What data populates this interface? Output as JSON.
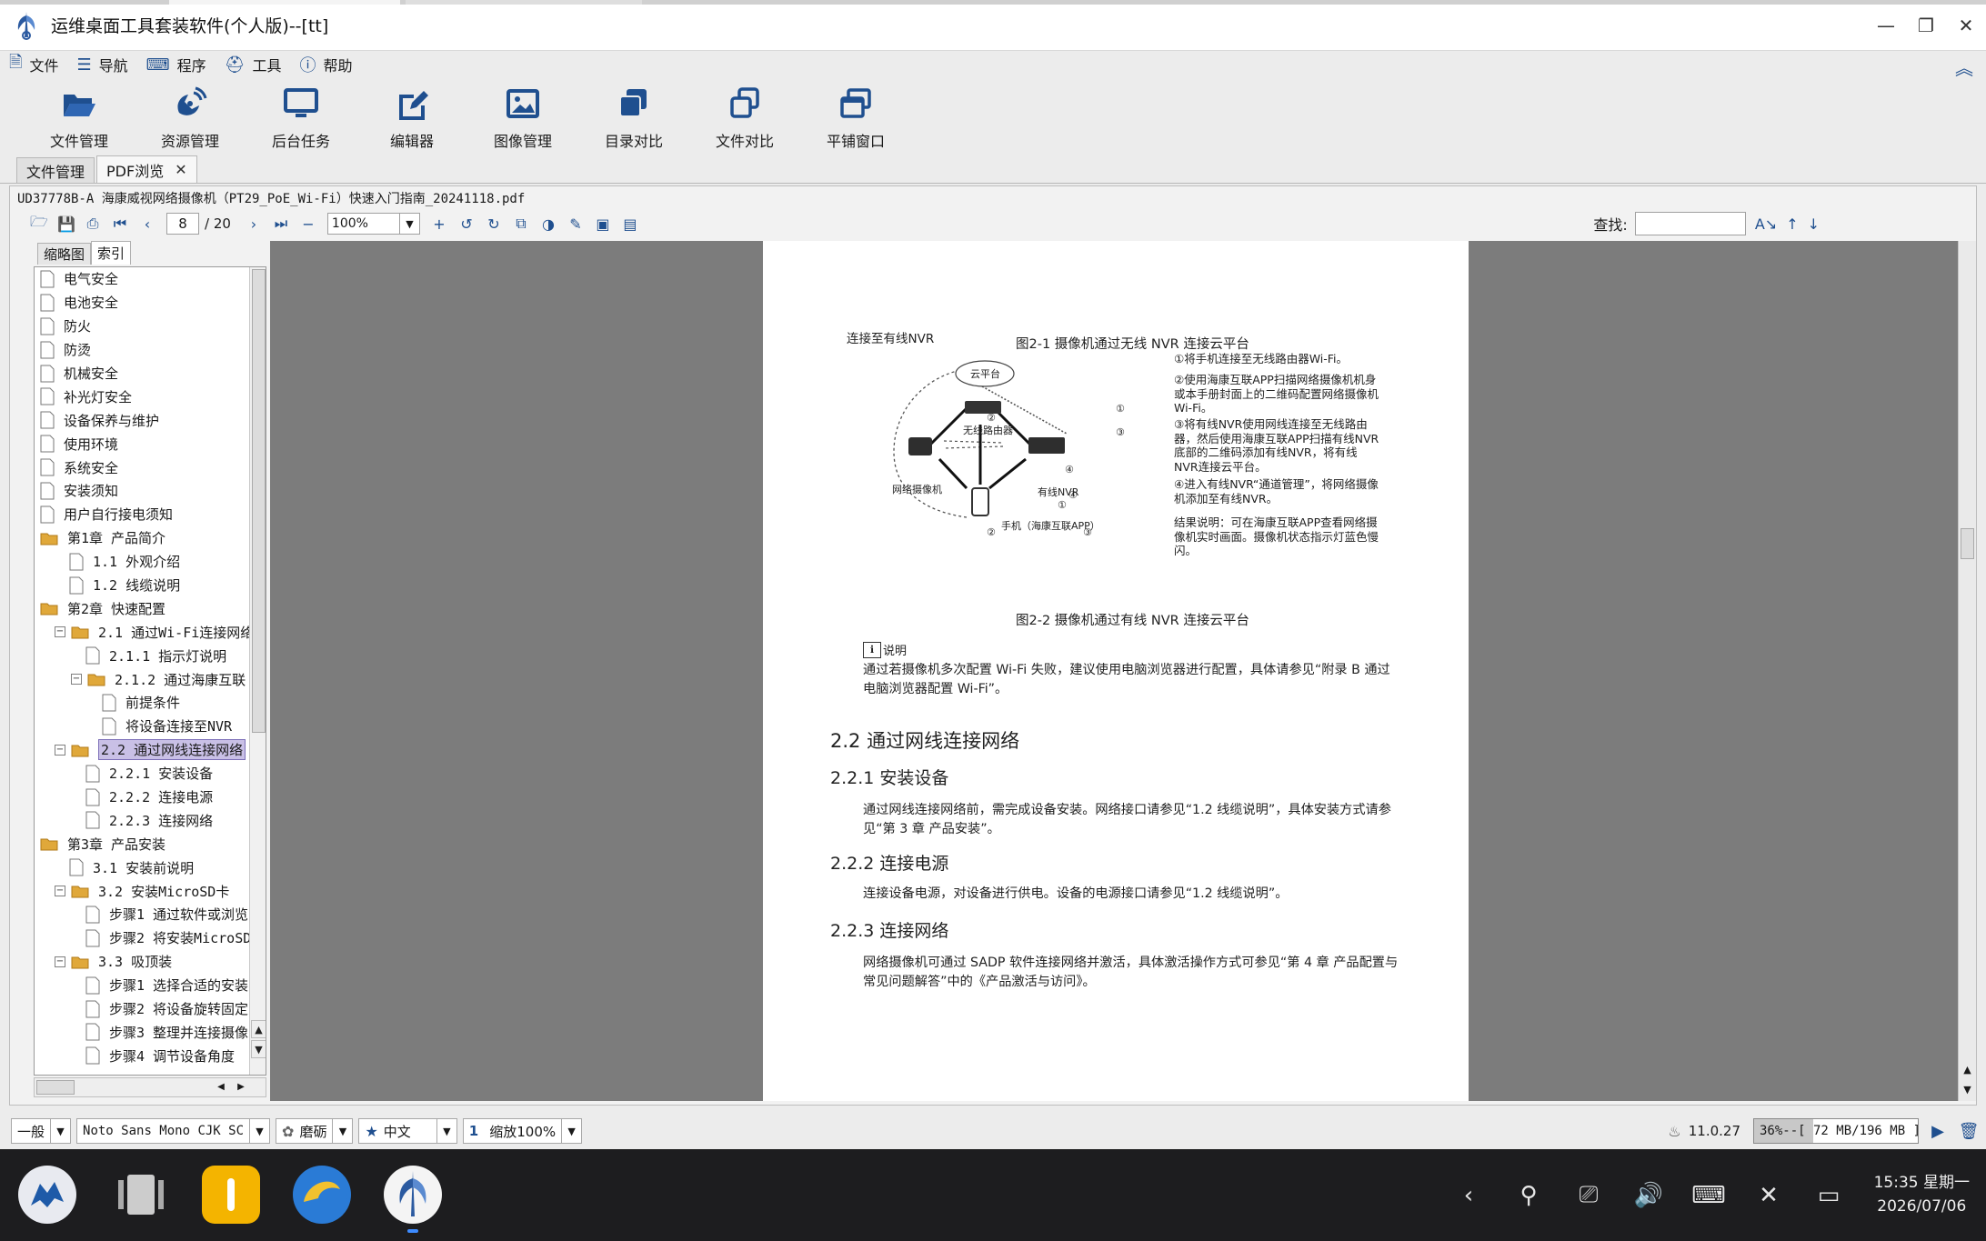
{
  "app": {
    "title": "运维桌面工具套装软件(个人版)--[tt]",
    "window_controls": [
      "minimize",
      "restore",
      "close"
    ]
  },
  "menu": [
    {
      "label": "文件",
      "icon": "file-icon"
    },
    {
      "label": "导航",
      "icon": "list-icon"
    },
    {
      "label": "程序",
      "icon": "keyboard-icon"
    },
    {
      "label": "工具",
      "icon": "toolbox-icon"
    },
    {
      "label": "帮助",
      "icon": "help-icon"
    }
  ],
  "ribbon": [
    {
      "label": "文件管理",
      "icon": "folder-open-icon"
    },
    {
      "label": "资源管理",
      "icon": "satellite-icon"
    },
    {
      "label": "后台任务",
      "icon": "monitor-icon"
    },
    {
      "label": "编辑器",
      "icon": "edit-icon"
    },
    {
      "label": "图像管理",
      "icon": "image-icon"
    },
    {
      "label": "目录对比",
      "icon": "copy-icon"
    },
    {
      "label": "文件对比",
      "icon": "files-compare-icon"
    },
    {
      "label": "平铺窗口",
      "icon": "windows-icon"
    }
  ],
  "doc_tabs": [
    {
      "label": "文件管理",
      "active": false
    },
    {
      "label": "PDF浏览",
      "active": true,
      "close": "✕"
    }
  ],
  "pdf": {
    "file_path": "UD37778B-A 海康威视网络摄像机（PT29_PoE_Wi-Fi）快速入门指南_20241118.pdf",
    "current_page": "8",
    "total_pages": "/ 20",
    "zoom": "100%",
    "search_label": "查找:",
    "search_value": ""
  },
  "sidebar": {
    "tabs": [
      {
        "label": "缩略图",
        "active": false
      },
      {
        "label": "索引",
        "active": true
      }
    ],
    "tree": [
      {
        "label": "电气安全",
        "level": 0,
        "type": "page"
      },
      {
        "label": "电池安全",
        "level": 0,
        "type": "page"
      },
      {
        "label": "防火",
        "level": 0,
        "type": "page"
      },
      {
        "label": "防烫",
        "level": 0,
        "type": "page"
      },
      {
        "label": "机械安全",
        "level": 0,
        "type": "page"
      },
      {
        "label": "补光灯安全",
        "level": 0,
        "type": "page"
      },
      {
        "label": "设备保养与维护",
        "level": 0,
        "type": "page"
      },
      {
        "label": "使用环境",
        "level": 0,
        "type": "page"
      },
      {
        "label": "系统安全",
        "level": 0,
        "type": "page"
      },
      {
        "label": "安装须知",
        "level": 0,
        "type": "page"
      },
      {
        "label": "用户自行接电须知",
        "level": 0,
        "type": "page"
      },
      {
        "label": "第1章  产品简介",
        "level": 0,
        "type": "folder"
      },
      {
        "label": "1.1  外观介绍",
        "level": 1,
        "type": "page"
      },
      {
        "label": "1.2  线缆说明",
        "level": 1,
        "type": "page"
      },
      {
        "label": "第2章  快速配置",
        "level": 0,
        "type": "folder"
      },
      {
        "label": "2.1  通过Wi-Fi连接网络",
        "level": 1,
        "type": "folder",
        "exp": "⊟"
      },
      {
        "label": "2.1.1  指示灯说明",
        "level": 2,
        "type": "page"
      },
      {
        "label": "2.1.2  通过海康互联",
        "level": 2,
        "type": "folder",
        "exp": "⊟"
      },
      {
        "label": "前提条件",
        "level": 3,
        "type": "page"
      },
      {
        "label": "将设备连接至NVR",
        "level": 3,
        "type": "page"
      },
      {
        "label": "2.2  通过网线连接网络",
        "level": 1,
        "type": "folder",
        "exp": "⊟",
        "selected": true
      },
      {
        "label": "2.2.1  安装设备",
        "level": 2,
        "type": "page"
      },
      {
        "label": "2.2.2  连接电源",
        "level": 2,
        "type": "page"
      },
      {
        "label": "2.2.3  连接网络",
        "level": 2,
        "type": "page"
      },
      {
        "label": "第3章  产品安装",
        "level": 0,
        "type": "folder"
      },
      {
        "label": "3.1  安装前说明",
        "level": 1,
        "type": "page"
      },
      {
        "label": "3.2  安装MicroSD卡",
        "level": 1,
        "type": "folder",
        "exp": "⊟"
      },
      {
        "label": "步骤1 通过软件或浏览",
        "level": 2,
        "type": "page"
      },
      {
        "label": "步骤2 将安装MicroSD",
        "level": 2,
        "type": "page"
      },
      {
        "label": "3.3  吸顶装",
        "level": 1,
        "type": "folder",
        "exp": "⊟"
      },
      {
        "label": "步骤1 选择合适的安装",
        "level": 2,
        "type": "page"
      },
      {
        "label": "步骤2 将设备旋转固定",
        "level": 2,
        "type": "page"
      },
      {
        "label": "步骤3 整理并连接摄像",
        "level": 2,
        "type": "page"
      },
      {
        "label": "步骤4 调节设备角度",
        "level": 2,
        "type": "page"
      }
    ]
  },
  "page_content": {
    "fig1_caption": "图2-1  摄像机通过无线 NVR 连接云平台",
    "diagram": {
      "label_wired_nvr_link": "连接至有线NVR",
      "cloud": "云平台",
      "router": "无线路由器",
      "camera": "网络摄像机",
      "nvr": "有线NVR",
      "phone": "手机（海康互联APP）",
      "steps": [
        "①将手机连接至无线路由器Wi-Fi。",
        "②使用海康互联APP扫描网络摄像机机身或本手册封面上的二维码配置网络摄像机Wi-Fi。",
        "③将有线NVR使用网线连接至无线路由器，然后使用海康互联APP扫描有线NVR底部的二维码添加有线NVR，将有线NVR连接云平台。",
        "④进入有线NVR“通道管理”，将网络摄像机添加至有线NVR。",
        "结果说明：可在海康互联APP查看网络摄像机实时画面。摄像机状态指示灯蓝色慢闪。"
      ],
      "numbers": [
        "①",
        "②",
        "③",
        "④",
        "①",
        "②",
        "③",
        "④"
      ]
    },
    "fig2_caption": "图2-2  摄像机通过有线 NVR 连接云平台",
    "note_label": "说明",
    "note_text": "通过若摄像机多次配置 Wi-Fi 失败，建议使用电脑浏览器进行配置，具体请参见“附录 B  通过电脑浏览器配置 Wi-Fi”。",
    "h2": "2.2  通过网线连接网络",
    "s1_title": "2.2.1  安装设备",
    "s1_text": "通过网线连接网络前，需完成设备安装。网络接口请参见“1.2  线缆说明”，具体安装方式请参见“第 3 章  产品安装”。",
    "s2_title": "2.2.2  连接电源",
    "s2_text": "连接设备电源，对设备进行供电。设备的电源接口请参见“1.2  线缆说明”。",
    "s3_title": "2.2.3  连接网络",
    "s3_text": "网络摄像机可通过 SADP 软件连接网络并激活，具体激活操作方式可参见“第 4 章  产品配置与常见问题解答”中的《产品激活与访问》。"
  },
  "statusbar": {
    "mode": "一般",
    "font": "Noto Sans Mono CJK SC",
    "theme": "磨砺",
    "lang": "中文",
    "num": "1",
    "zoom": "缩放100%",
    "java_version": "11.0.27",
    "memory": "36%--[ 72 MB/196 MB ]",
    "memory_fraction": 0.36
  },
  "taskbar": {
    "time": "15:35 星期一",
    "date": "2026/07/06"
  },
  "colors": {
    "accent": "#1f4f8f",
    "viewer_bg": "#7c7c7c",
    "selection": "#c9c0e6",
    "taskbar": "#1d1d1f"
  }
}
